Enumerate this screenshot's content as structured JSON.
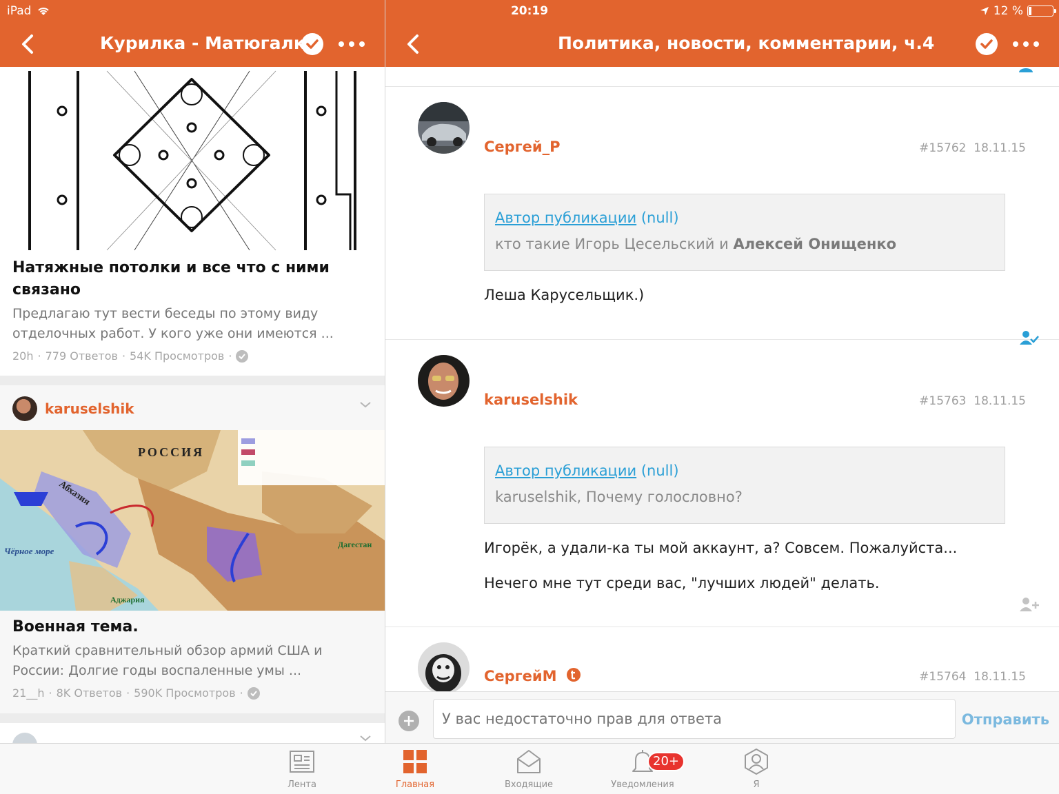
{
  "status_bar": {
    "device": "iPad",
    "time": "20:19",
    "battery": "12 %",
    "battery_level": 0.12
  },
  "left_nav": {
    "title": "Курилка - Матюгалка"
  },
  "right_nav": {
    "title": "Политика, новости, комментарии, ч.4"
  },
  "feed": [
    {
      "title": "Натяжные потолки и все что с ними связано",
      "excerpt": "Предлагаю тут вести беседы по этому виду отделочных работ. У кого уже они имеются ...",
      "meta_time": "20h",
      "meta_answers": "779 Ответов",
      "meta_views": "54K Просмотров"
    },
    {
      "author": "karuselshik",
      "map_labels": [
        "РОССИЯ",
        "Абхазия",
        "Чёрное море",
        "Дагестан",
        "Аджария"
      ],
      "title": "Военная тема.",
      "excerpt": "Краткий сравнительный обзор армий США и России: Долгие годы воспаленные умы ...",
      "meta_time": "21__h",
      "meta_answers": "8K Ответов",
      "meta_views": "590K Просмотров"
    }
  ],
  "thread": [
    {
      "author": "Сергей_Р",
      "post_no": "#15762",
      "date": "18.11.15",
      "quote_link": "Автор публикации",
      "quote_null": "(null)",
      "quote_text_start": "кто такие Игорь Цесельский и",
      "quote_text_bold": "Алексей Онищенко",
      "body": [
        "Леша Карусельщик.)"
      ]
    },
    {
      "author": "karuselshik",
      "post_no": "#15763",
      "date": "18.11.15",
      "quote_link": "Автор публикации",
      "quote_null": "(null)",
      "quote_text_start": "karuselshik, Почему голословно?",
      "quote_text_bold": "",
      "body": [
        "Игорёк, а удали-ка ты мой аккаунт, а? Совсем. Пожалуйста...",
        "Нечего мне тут среди вас, \"лучших людей\" делать."
      ]
    },
    {
      "author": "СергейМ",
      "post_no": "#15764",
      "date": "18.11.15"
    }
  ],
  "reply": {
    "placeholder": "У вас недостаточно прав для ответа",
    "send_label": "Отправить"
  },
  "tabs": [
    {
      "label": "Лента",
      "icon": "feed-icon"
    },
    {
      "label": "Главная",
      "icon": "home-grid-icon",
      "active": true
    },
    {
      "label": "Входящие",
      "icon": "inbox-icon"
    },
    {
      "label": "Уведомления",
      "icon": "bell-icon",
      "badge": "20+"
    },
    {
      "label": "Я",
      "icon": "profile-icon"
    }
  ],
  "colors": {
    "brand": "#e2642e",
    "link": "#2a9fd6",
    "badge": "#e8332e"
  }
}
